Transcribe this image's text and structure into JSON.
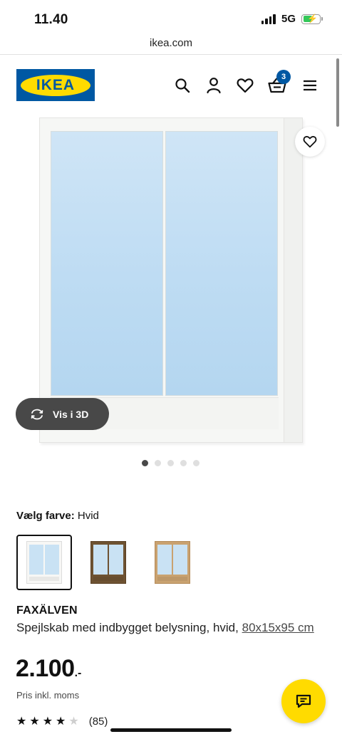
{
  "status_bar": {
    "time": "11.40",
    "network": "5G",
    "battery_color": "#34c759"
  },
  "browser": {
    "url": "ikea.com"
  },
  "header": {
    "logo_text": "IKEA",
    "cart_count": "3",
    "icons": [
      "search-icon",
      "account-icon",
      "wishlist-icon",
      "cart-icon",
      "menu-icon"
    ],
    "brand_blue": "#0058a3",
    "brand_yellow": "#ffdb00"
  },
  "gallery": {
    "view_3d_label": "Vis i 3D",
    "dots_count": 5,
    "active_dot": 1
  },
  "color_selector": {
    "label": "Vælg farve:",
    "selected_value": "Hvid",
    "options": [
      "white",
      "brown-oak",
      "light-oak"
    ]
  },
  "product": {
    "name": "FAXÄLVEN",
    "description": "Spejlskab med indbygget belysning, hvid,",
    "size_link": "80x15x95 cm",
    "price": "2.100",
    "price_suffix": ".-",
    "price_note": "Pris inkl. moms",
    "rating_stars": 4,
    "rating_max": 5,
    "review_count": "(85)"
  }
}
